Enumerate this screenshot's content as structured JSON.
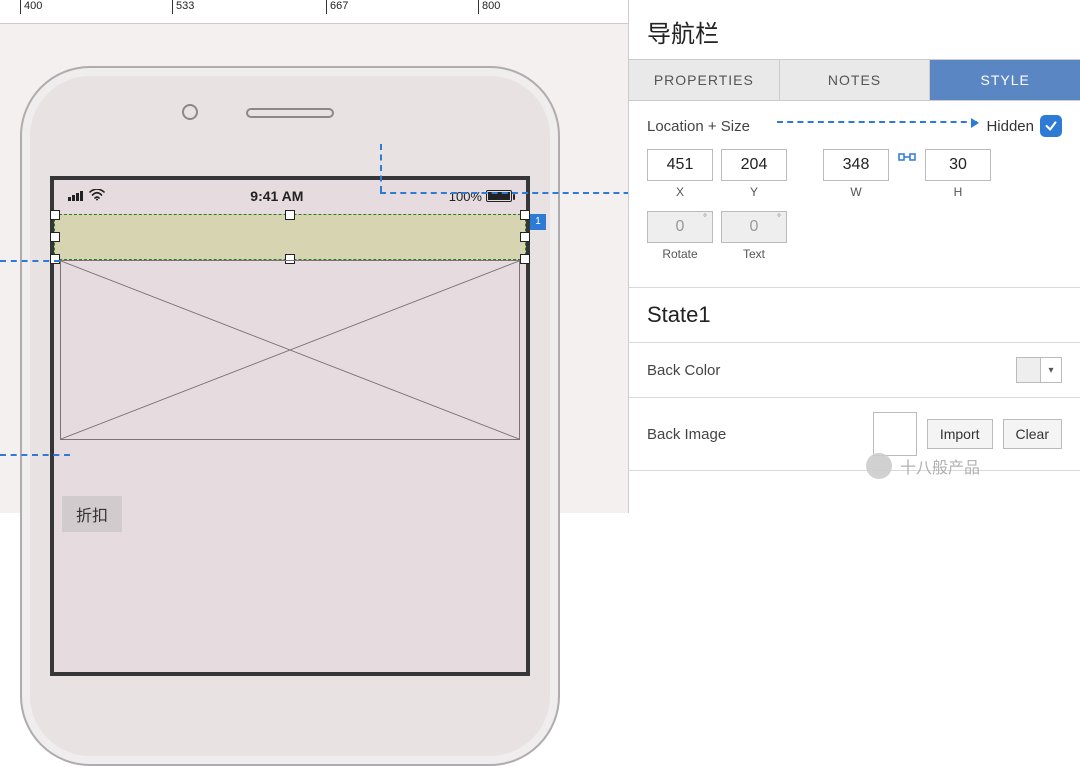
{
  "ruler": {
    "ticks": [
      "400",
      "533",
      "667",
      "800"
    ]
  },
  "canvas": {
    "status_time": "9:41 AM",
    "battery_pct": "100%",
    "selected_badge": "1",
    "label_chip": "折扣"
  },
  "inspector": {
    "title": "导航栏",
    "tabs": {
      "properties": "PROPERTIES",
      "notes": "NOTES",
      "style": "STYLE"
    },
    "loc_size_label": "Location + Size",
    "hidden_label": "Hidden",
    "hidden_checked": true,
    "x": "451",
    "y": "204",
    "w": "348",
    "h": "30",
    "x_lbl": "X",
    "y_lbl": "Y",
    "w_lbl": "W",
    "h_lbl": "H",
    "rotate": "0",
    "text_rot": "0",
    "rotate_lbl": "Rotate",
    "text_lbl": "Text",
    "state_title": "State1",
    "back_color_label": "Back Color",
    "back_image_label": "Back Image",
    "import_btn": "Import",
    "clear_btn": "Clear"
  },
  "watermark": "十八般产品"
}
